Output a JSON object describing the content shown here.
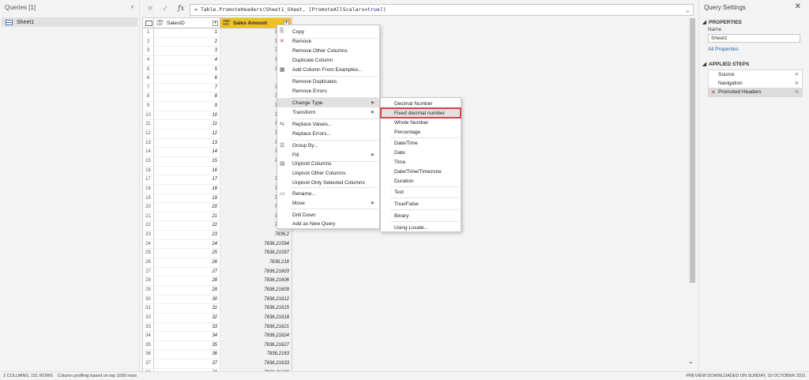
{
  "queries": {
    "header": "Queries [1]",
    "items": [
      {
        "label": "Sheet1"
      }
    ]
  },
  "formula": {
    "prefix": "= Table.PromoteHeaders(Sheet1_Sheet, [PromoteAllScalars=",
    "keyword": "true",
    "suffix": "])"
  },
  "grid": {
    "columns": [
      {
        "name": "SalesID",
        "type_badge": "ABC 123"
      },
      {
        "name": "Sales Amount",
        "type_badge": "ABC 123"
      }
    ],
    "rows": [
      {
        "n": "1",
        "id": "1",
        "amt": "7836,2"
      },
      {
        "n": "2",
        "id": "2",
        "amt": "7836,2"
      },
      {
        "n": "3",
        "id": "3",
        "amt": "7836,2"
      },
      {
        "n": "4",
        "id": "4",
        "amt": "7836,2"
      },
      {
        "n": "5",
        "id": "5",
        "amt": "7836,2"
      },
      {
        "n": "6",
        "id": "6",
        "amt": "7836,"
      },
      {
        "n": "7",
        "id": "7",
        "amt": "7836,2"
      },
      {
        "n": "8",
        "id": "8",
        "amt": "7836,2"
      },
      {
        "n": "9",
        "id": "9",
        "amt": "7836,2"
      },
      {
        "n": "10",
        "id": "10",
        "amt": "7836,2"
      },
      {
        "n": "11",
        "id": "11",
        "amt": "7836,2"
      },
      {
        "n": "12",
        "id": "12",
        "amt": "7836,2"
      },
      {
        "n": "13",
        "id": "13",
        "amt": "7836,2"
      },
      {
        "n": "14",
        "id": "14",
        "amt": "7836,2"
      },
      {
        "n": "15",
        "id": "15",
        "amt": "7836,2"
      },
      {
        "n": "16",
        "id": "16",
        "amt": "7836,"
      },
      {
        "n": "17",
        "id": "17",
        "amt": "7836,2"
      },
      {
        "n": "18",
        "id": "18",
        "amt": "7836,2"
      },
      {
        "n": "19",
        "id": "19",
        "amt": "7836,2"
      },
      {
        "n": "20",
        "id": "20",
        "amt": "7836,2"
      },
      {
        "n": "21",
        "id": "21",
        "amt": "7836,2"
      },
      {
        "n": "22",
        "id": "22",
        "amt": "7836,2"
      },
      {
        "n": "23",
        "id": "23",
        "amt": "7836,2"
      },
      {
        "n": "24",
        "id": "24",
        "amt": "7836,21594"
      },
      {
        "n": "25",
        "id": "25",
        "amt": "7836,21597"
      },
      {
        "n": "26",
        "id": "26",
        "amt": "7836,216"
      },
      {
        "n": "27",
        "id": "27",
        "amt": "7836,21603"
      },
      {
        "n": "28",
        "id": "28",
        "amt": "7836,21606"
      },
      {
        "n": "29",
        "id": "29",
        "amt": "7836,21609"
      },
      {
        "n": "30",
        "id": "30",
        "amt": "7836,21612"
      },
      {
        "n": "31",
        "id": "31",
        "amt": "7836,21615"
      },
      {
        "n": "32",
        "id": "32",
        "amt": "7836,21618"
      },
      {
        "n": "33",
        "id": "33",
        "amt": "7836,21621"
      },
      {
        "n": "34",
        "id": "34",
        "amt": "7836,21624"
      },
      {
        "n": "35",
        "id": "35",
        "amt": "7836,21627"
      },
      {
        "n": "36",
        "id": "36",
        "amt": "7836,2163"
      },
      {
        "n": "37",
        "id": "37",
        "amt": "7836,21633"
      },
      {
        "n": "38",
        "id": "38",
        "amt": "7836,21636"
      },
      {
        "n": "39",
        "id": "39",
        "amt": "7836,21639"
      }
    ]
  },
  "context_menu": {
    "copy": "Copy",
    "remove": "Remove",
    "remove_other": "Remove Other Columns",
    "duplicate": "Duplicate Column",
    "add_from_examples": "Add Column From Examples...",
    "remove_duplicates": "Remove Duplicates",
    "remove_errors": "Remove Errors",
    "change_type": "Change Type",
    "transform": "Transform",
    "replace_values": "Replace Values...",
    "replace_errors": "Replace Errors...",
    "group_by": "Group By...",
    "fill": "Fill",
    "unpivot": "Unpivot Columns",
    "unpivot_other": "Unpivot Other Columns",
    "unpivot_selected": "Unpivot Only Selected Columns",
    "rename": "Rename...",
    "move": "Move",
    "drill_down": "Drill Down",
    "add_new_query": "Add as New Query"
  },
  "type_submenu": {
    "decimal": "Decimal Number",
    "fixed_decimal": "Fixed decimal number",
    "whole": "Whole Number",
    "percentage": "Percentage",
    "datetime": "Date/Time",
    "date": "Date",
    "time": "Time",
    "datetimezone": "Date/Time/Timezone",
    "duration": "Duration",
    "text": "Text",
    "truefalse": "True/False",
    "binary": "Binary",
    "locale": "Using Locale..."
  },
  "settings": {
    "title": "Query Settings",
    "properties_head": "PROPERTIES",
    "name_label": "Name",
    "name_value": "Sheet1",
    "all_properties": "All Properties",
    "steps_head": "APPLIED STEPS",
    "steps": [
      {
        "label": "Source"
      },
      {
        "label": "Navigation"
      },
      {
        "label": "Promoted Headers"
      }
    ]
  },
  "status": {
    "left": "2 COLUMNS, 151 ROWS",
    "profile": "Column profiling based on top 1000 rows",
    "right": "PREVIEW DOWNLOADED ON SUNDAY, 10 OCTOBER 2021"
  }
}
